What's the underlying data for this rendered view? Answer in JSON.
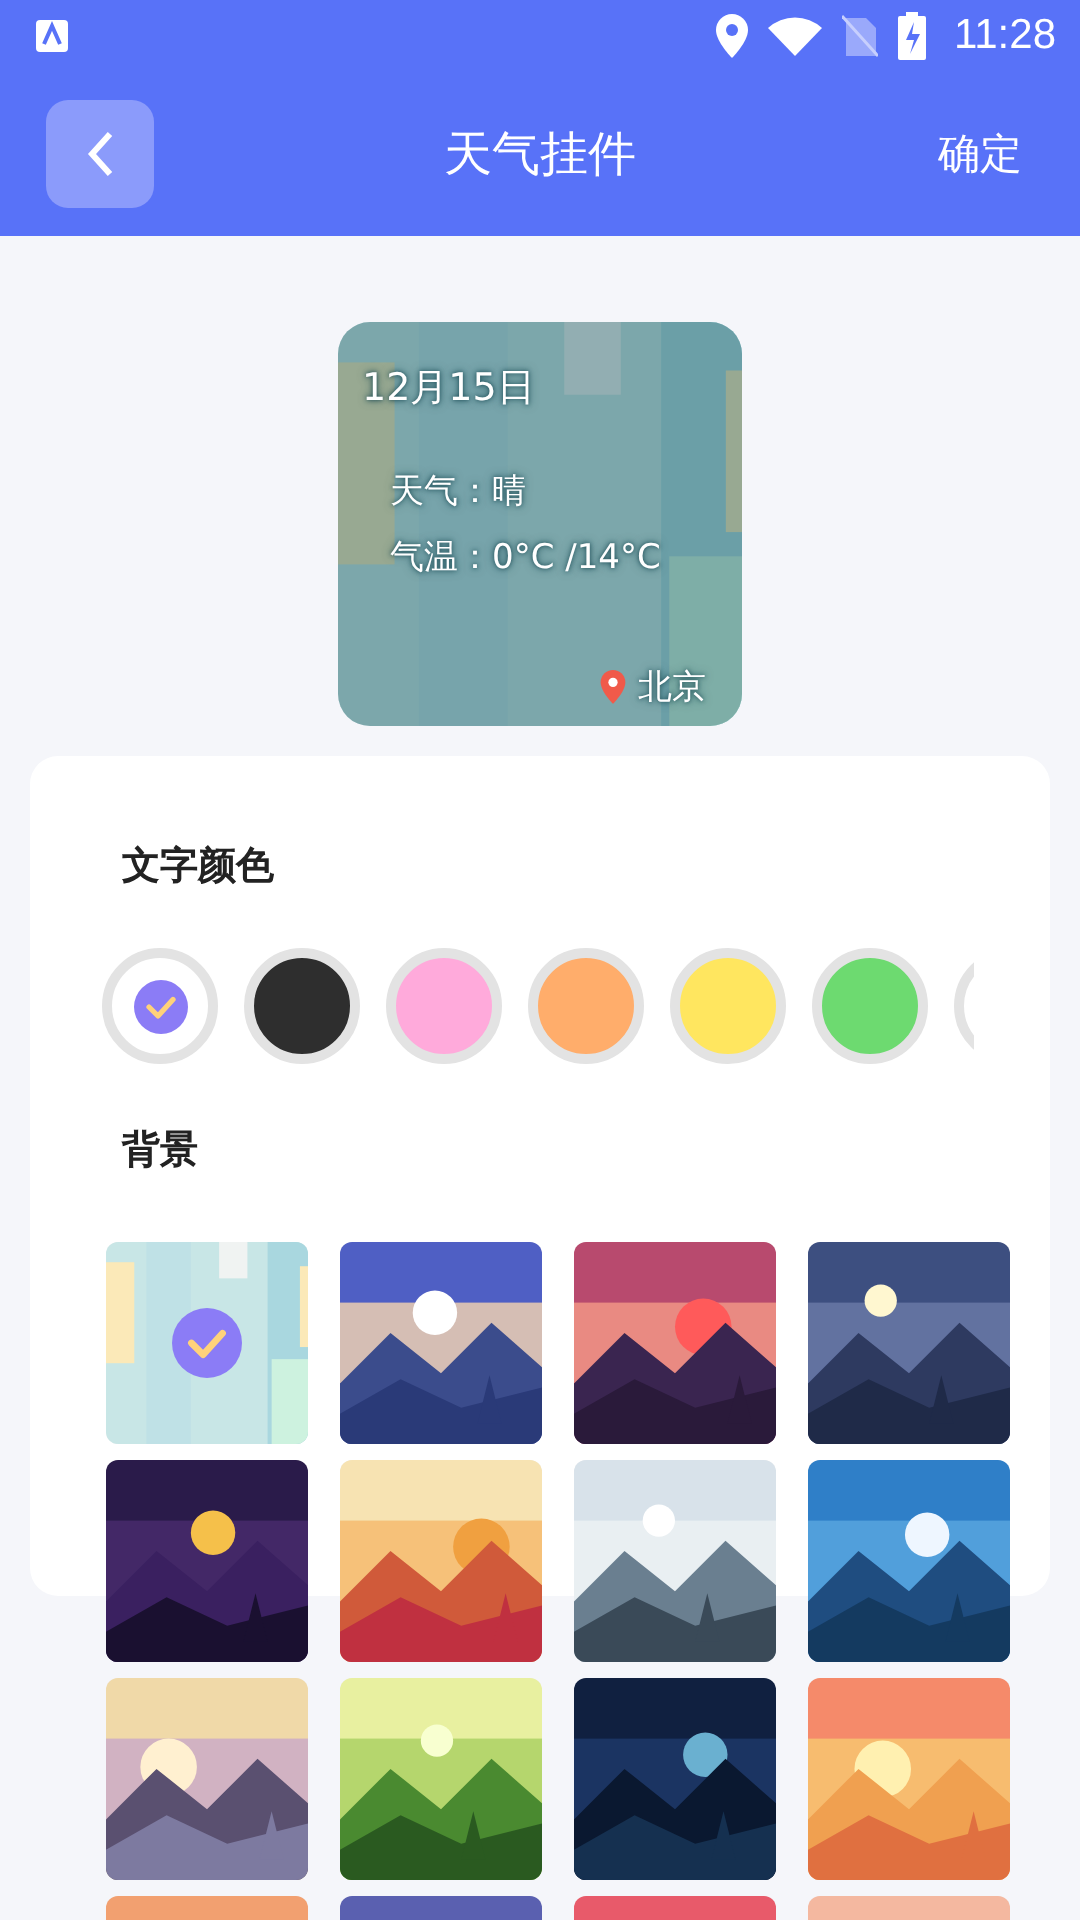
{
  "status_bar": {
    "time": "11:28"
  },
  "header": {
    "title": "天气挂件",
    "confirm": "确定"
  },
  "preview": {
    "date": "12月15日",
    "weather": "天气：晴",
    "temperature": "气温：0°C /14°C",
    "city": "北京"
  },
  "text_color": {
    "title": "文字颜色",
    "swatches": [
      {
        "color": "#ffffff",
        "selected": true
      },
      {
        "color": "#2e2e2e",
        "selected": false
      },
      {
        "color": "#ffaadb",
        "selected": false
      },
      {
        "color": "#ffad6b",
        "selected": false
      },
      {
        "color": "#ffe65f",
        "selected": false
      },
      {
        "color": "#6dda70",
        "selected": false
      },
      {
        "color": "#ffffff"
      }
    ]
  },
  "background": {
    "title": "背景",
    "items": [
      {
        "kind": "picture",
        "selected": true
      },
      {
        "kind": "picture",
        "selected": false
      },
      {
        "kind": "picture",
        "selected": false
      },
      {
        "kind": "picture",
        "selected": false
      },
      {
        "kind": "picture",
        "selected": false
      },
      {
        "kind": "picture",
        "selected": false
      },
      {
        "kind": "picture",
        "selected": false
      },
      {
        "kind": "picture",
        "selected": false
      },
      {
        "kind": "picture",
        "selected": false
      },
      {
        "kind": "picture",
        "selected": false
      },
      {
        "kind": "picture",
        "selected": false
      },
      {
        "kind": "picture",
        "selected": false
      },
      {
        "kind": "picture"
      },
      {
        "kind": "picture"
      },
      {
        "kind": "picture"
      },
      {
        "kind": "picture"
      }
    ]
  }
}
